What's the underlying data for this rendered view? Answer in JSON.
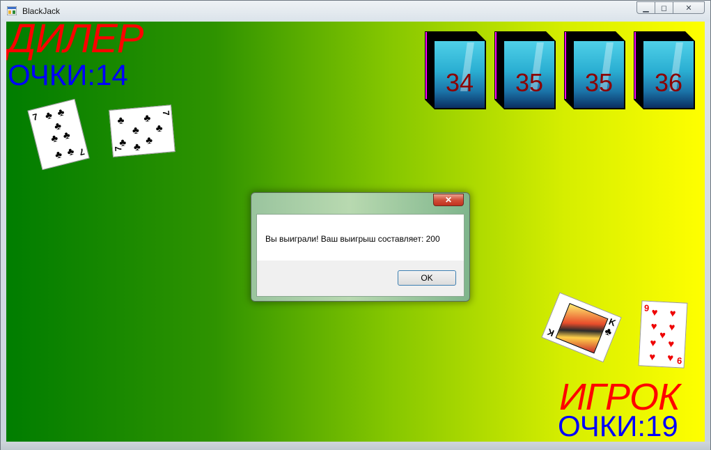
{
  "window": {
    "title": "BlackJack",
    "controls": {
      "minimize": "▁",
      "maximize": "◻",
      "close": "✕"
    }
  },
  "game": {
    "dealer_label": "ДИЛЕР",
    "dealer_score": "ОЧКИ:14",
    "player_label": "ИГРОК",
    "player_score": "ОЧКИ:19",
    "decks": [
      "34",
      "35",
      "35",
      "36"
    ],
    "dealer_cards": [
      {
        "rank": "7",
        "suit": "club-icon"
      },
      {
        "rank": "7",
        "suit": "club-icon"
      }
    ],
    "player_cards": [
      {
        "rank": "K",
        "suit": "club-icon"
      },
      {
        "rank": "9",
        "suit": "heart-icon"
      }
    ]
  },
  "dialog": {
    "message": "Вы выиграли! Ваш выигрыш составляет: 200",
    "ok_label": "OK",
    "close_label": "✕"
  },
  "colors": {
    "gradient_left": "#007d00",
    "gradient_right": "#ffff00",
    "title_red": "#ff0000",
    "score_blue": "#0000ff",
    "deck_number": "#8b0000"
  }
}
